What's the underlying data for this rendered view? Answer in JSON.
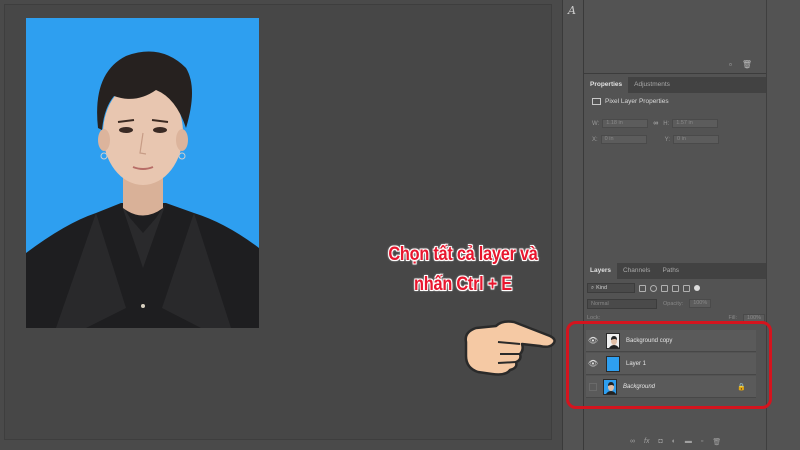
{
  "annotation": {
    "line1": "Chọn tất cả layer và",
    "line2": "nhấn Ctrl + E",
    "color": "#e8162e",
    "box_color": "#d4141e"
  },
  "document": {
    "background_color": "#2e9ff0"
  },
  "properties_panel": {
    "tabs": [
      "Properties",
      "Adjustments"
    ],
    "active_tab": "Properties",
    "title": "Pixel Layer Properties",
    "w_label": "W:",
    "w_value": "1.18 in",
    "h_label": "H:",
    "h_value": "1.57 in",
    "x_label": "X:",
    "x_value": "0 in",
    "y_label": "Y:",
    "y_value": "0 in"
  },
  "layers_panel": {
    "tabs": [
      "Layers",
      "Channels",
      "Paths"
    ],
    "active_tab": "Layers",
    "filter_label": "Kind",
    "blend_mode": "Normal",
    "opacity_label": "Opacity:",
    "opacity_value": "100%",
    "lock_label": "Lock:",
    "fill_label": "Fill:",
    "fill_value": "100%",
    "layers": [
      {
        "name": "Background copy",
        "visible": true,
        "thumb": "portrait",
        "locked": false
      },
      {
        "name": "Layer 1",
        "visible": true,
        "thumb": "blue",
        "locked": false
      },
      {
        "name": "Background",
        "visible": false,
        "thumb": "portrait",
        "locked": true
      }
    ],
    "footer_icons": [
      "link-icon",
      "fx-icon",
      "mask-icon",
      "adjustment-icon",
      "folder-icon",
      "new-layer-icon",
      "trash-icon"
    ]
  }
}
